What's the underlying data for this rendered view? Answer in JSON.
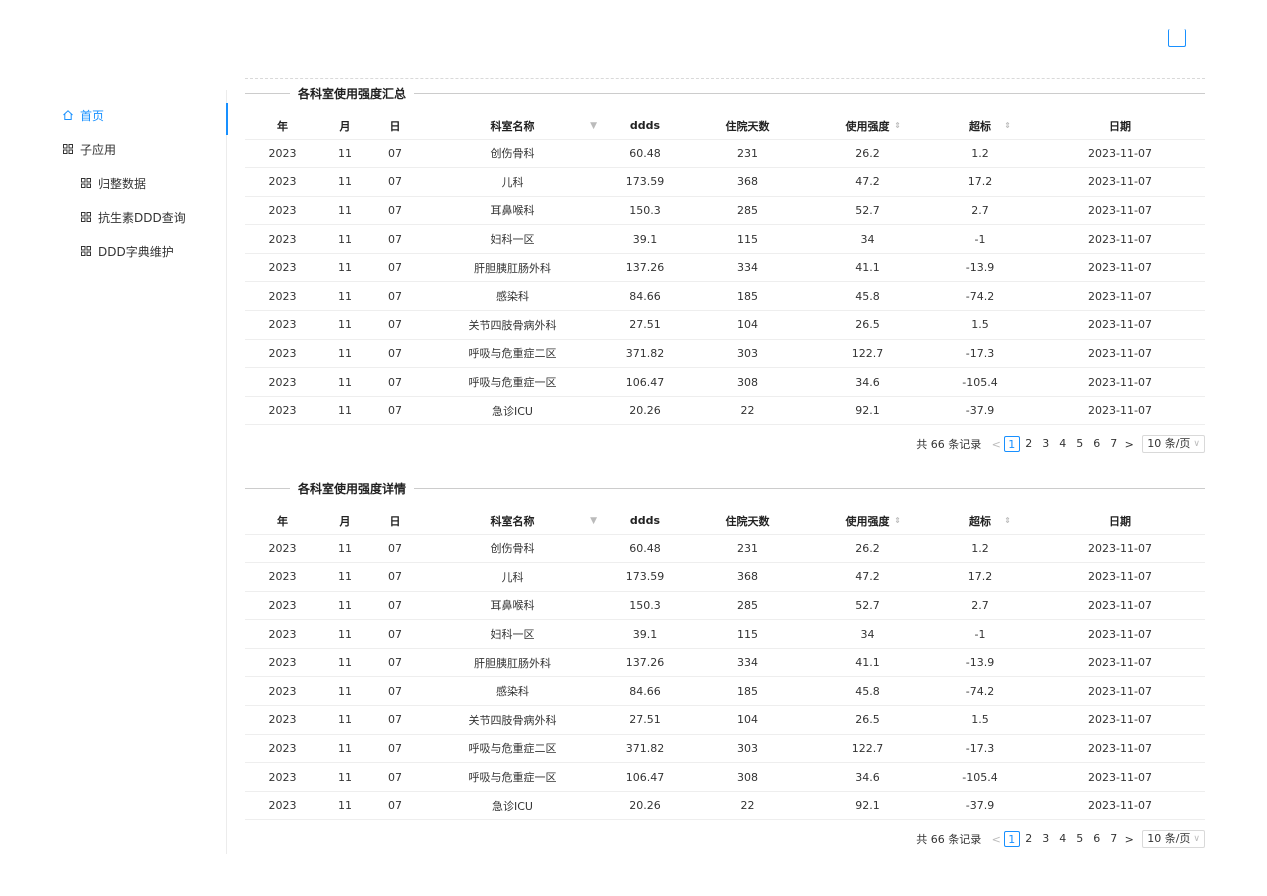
{
  "sidebar": {
    "items": [
      {
        "label": "首页",
        "icon": "home-icon"
      },
      {
        "label": "子应用",
        "icon": "grid-icon"
      },
      {
        "label": "归整数据",
        "icon": "grid-icon"
      },
      {
        "label": "抗生素DDD查询",
        "icon": "grid-icon"
      },
      {
        "label": "DDD字典维护",
        "icon": "grid-icon"
      }
    ]
  },
  "colors": {
    "accent": "#1890ff",
    "border": "#eeeeee"
  },
  "columns": [
    "年",
    "月",
    "日",
    "科室名称",
    "ddds",
    "住院天数",
    "使用强度",
    "超标",
    "日期"
  ],
  "sections": [
    {
      "title": "各科室使用强度汇总"
    },
    {
      "title": "各科室使用强度详情"
    }
  ],
  "rows": [
    [
      "2023",
      "11",
      "07",
      "创伤骨科",
      "60.48",
      "231",
      "26.2",
      "1.2",
      "2023-11-07"
    ],
    [
      "2023",
      "11",
      "07",
      "儿科",
      "173.59",
      "368",
      "47.2",
      "17.2",
      "2023-11-07"
    ],
    [
      "2023",
      "11",
      "07",
      "耳鼻喉科",
      "150.3",
      "285",
      "52.7",
      "2.7",
      "2023-11-07"
    ],
    [
      "2023",
      "11",
      "07",
      "妇科一区",
      "39.1",
      "115",
      "34",
      "-1",
      "2023-11-07"
    ],
    [
      "2023",
      "11",
      "07",
      "肝胆胰肛肠外科",
      "137.26",
      "334",
      "41.1",
      "-13.9",
      "2023-11-07"
    ],
    [
      "2023",
      "11",
      "07",
      "感染科",
      "84.66",
      "185",
      "45.8",
      "-74.2",
      "2023-11-07"
    ],
    [
      "2023",
      "11",
      "07",
      "关节四肢骨病外科",
      "27.51",
      "104",
      "26.5",
      "1.5",
      "2023-11-07"
    ],
    [
      "2023",
      "11",
      "07",
      "呼吸与危重症二区",
      "371.82",
      "303",
      "122.7",
      "-17.3",
      "2023-11-07"
    ],
    [
      "2023",
      "11",
      "07",
      "呼吸与危重症一区",
      "106.47",
      "308",
      "34.6",
      "-105.4",
      "2023-11-07"
    ],
    [
      "2023",
      "11",
      "07",
      "急诊ICU",
      "20.26",
      "22",
      "92.1",
      "-37.9",
      "2023-11-07"
    ]
  ],
  "pagination": {
    "total": "共 66 条记录",
    "prev": "<",
    "next": ">",
    "pages": [
      "1",
      "2",
      "3",
      "4",
      "5",
      "6",
      "7"
    ],
    "current": "1",
    "page_size": "10 条/页"
  }
}
